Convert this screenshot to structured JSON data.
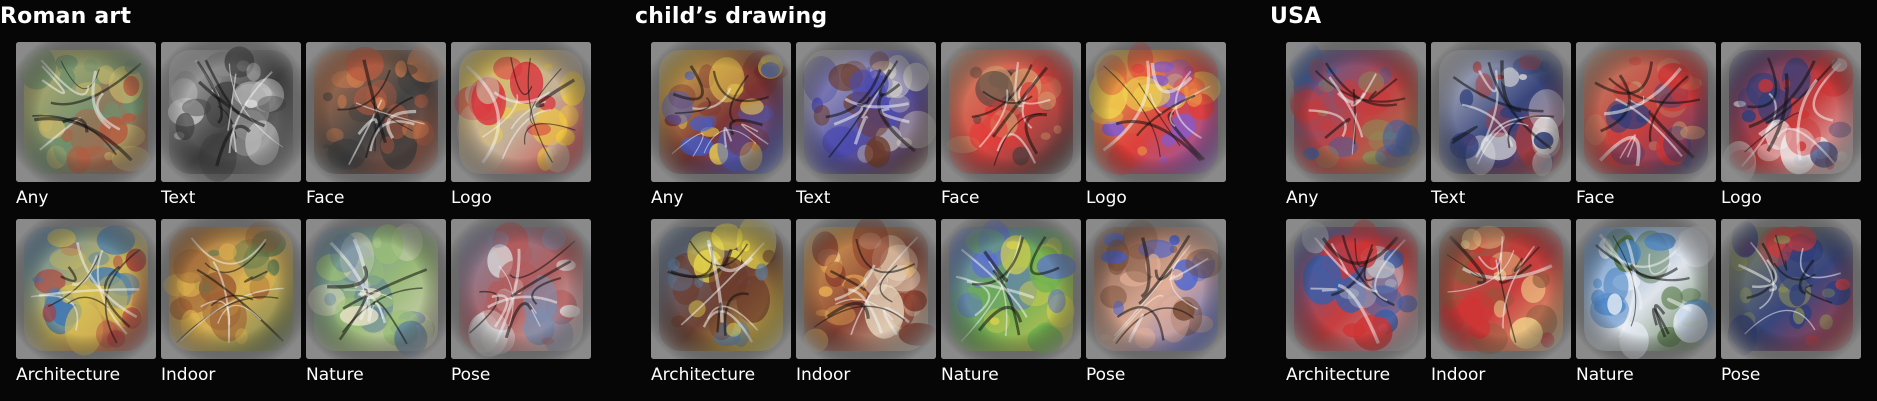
{
  "groups": [
    {
      "title": "Roman art",
      "tiles": [
        {
          "label": "Any",
          "icon": "roman-bird-sculpture",
          "palette": [
            "#c9b86a",
            "#6f8f6c",
            "#b45a3f"
          ]
        },
        {
          "label": "Text",
          "icon": "roman-text-relief",
          "palette": [
            "#d9d9d9",
            "#3b3b3b",
            "#8a8a8a"
          ]
        },
        {
          "label": "Face",
          "icon": "roman-laurel-face",
          "palette": [
            "#d27d4e",
            "#3c3c3c",
            "#b85b40"
          ]
        },
        {
          "label": "Logo",
          "icon": "roman-heraldic-shield",
          "palette": [
            "#f2cf3d",
            "#c9b49a",
            "#d9363e"
          ]
        },
        {
          "label": "Architecture",
          "icon": "roman-palace",
          "palette": [
            "#3e78b6",
            "#d7c054",
            "#ae3b3b"
          ]
        },
        {
          "label": "Indoor",
          "icon": "roman-heraldic-hall",
          "palette": [
            "#9b5d33",
            "#e0b54f",
            "#5f7b4f"
          ]
        },
        {
          "label": "Nature",
          "icon": "roman-mythic-landscape",
          "palette": [
            "#5b7ea3",
            "#9bbf77",
            "#e9e1c6"
          ]
        },
        {
          "label": "Pose",
          "icon": "roman-warriors",
          "palette": [
            "#7e8dad",
            "#b45a5a",
            "#dcdcdc"
          ]
        }
      ]
    },
    {
      "title": "child’s drawing",
      "tiles": [
        {
          "label": "Any",
          "icon": "crayon-face",
          "palette": [
            "#f0d14e",
            "#7b2d2d",
            "#3f5fd6"
          ]
        },
        {
          "label": "Text",
          "icon": "crayon-text",
          "palette": [
            "#d7d2c4",
            "#4c4ab0",
            "#6c3b2b"
          ]
        },
        {
          "label": "Face",
          "icon": "crayon-round-face",
          "palette": [
            "#d49569",
            "#e23c38",
            "#3b3b3b"
          ]
        },
        {
          "label": "Logo",
          "icon": "crayon-two-faces",
          "palette": [
            "#f0d14e",
            "#e23c38",
            "#7f5cd7"
          ]
        },
        {
          "label": "Architecture",
          "icon": "crayon-house",
          "palette": [
            "#5b7ea3",
            "#6c3b2b",
            "#f2e04a"
          ]
        },
        {
          "label": "Indoor",
          "icon": "crayon-room",
          "palette": [
            "#f0b657",
            "#8a3b2b",
            "#f0e4c9"
          ]
        },
        {
          "label": "Nature",
          "icon": "crayon-field",
          "palette": [
            "#5b6fd6",
            "#6fb24f",
            "#d8d04e"
          ]
        },
        {
          "label": "Pose",
          "icon": "crayon-figure",
          "palette": [
            "#7a4e38",
            "#e6b199",
            "#3f5fd6"
          ]
        }
      ]
    },
    {
      "title": "USA",
      "tiles": [
        {
          "label": "Any",
          "icon": "us-soldier-flag",
          "palette": [
            "#3a5ea8",
            "#c93a3a",
            "#8a8f58"
          ]
        },
        {
          "label": "Text",
          "icon": "us-text-banner",
          "palette": [
            "#dadada",
            "#2f3e7b",
            "#b13a3a"
          ]
        },
        {
          "label": "Face",
          "icon": "us-portrait-face",
          "palette": [
            "#c58e68",
            "#cf3535",
            "#2f3e7b"
          ]
        },
        {
          "label": "Logo",
          "icon": "us-flag-logo",
          "palette": [
            "#2f3e7b",
            "#cf3535",
            "#eeeeee"
          ]
        },
        {
          "label": "Architecture",
          "icon": "us-capitol-flags",
          "palette": [
            "#3a5ea8",
            "#cf3535",
            "#b7c1c9"
          ]
        },
        {
          "label": "Indoor",
          "icon": "us-interior-flags",
          "palette": [
            "#8b5a3c",
            "#cf3535",
            "#f2d08a"
          ]
        },
        {
          "label": "Nature",
          "icon": "us-mountain-landscape",
          "palette": [
            "#4d86c6",
            "#e8eef6",
            "#4b6e3a"
          ]
        },
        {
          "label": "Pose",
          "icon": "us-soldiers-hug",
          "palette": [
            "#8a8f58",
            "#2f3e7b",
            "#c93a3a"
          ]
        }
      ]
    }
  ]
}
